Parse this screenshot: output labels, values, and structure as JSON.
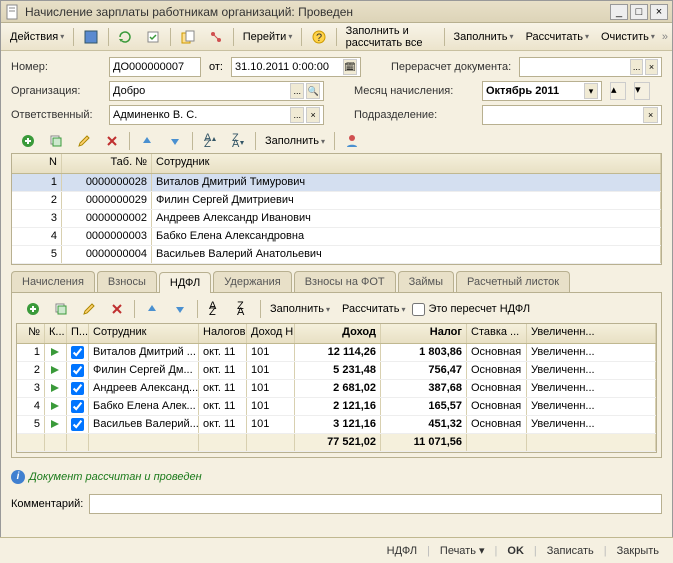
{
  "window": {
    "title": "Начисление зарплаты работникам организаций: Проведен"
  },
  "toolbar_main": {
    "actions": "Действия",
    "goto": "Перейти",
    "fill_calc_all": "Заполнить и рассчитать все",
    "fill": "Заполнить",
    "calc": "Рассчитать",
    "clear": "Очистить"
  },
  "form": {
    "number_label": "Номер:",
    "number_value": "ДО000000007",
    "date_from": "от:",
    "date_value": "31.10.2011 0:00:00",
    "org_label": "Организация:",
    "org_value": "Добро",
    "resp_label": "Ответственный:",
    "resp_value": "Админенко В. С.",
    "recalc_label": "Перерасчет документа:",
    "recalc_value": "",
    "month_label": "Месяц начисления:",
    "month_value": "Октябрь 2011",
    "dept_label": "Подразделение:",
    "dept_value": ""
  },
  "mini_tb": {
    "fill": "Заполнить"
  },
  "grid1": {
    "cols": {
      "n": "N",
      "tab": "Таб. №",
      "emp": "Сотрудник"
    },
    "rows": [
      {
        "n": "1",
        "tab": "0000000028",
        "emp": "Виталов Дмитрий Тимурович"
      },
      {
        "n": "2",
        "tab": "0000000029",
        "emp": "Филин Сергей Дмитриевич"
      },
      {
        "n": "3",
        "tab": "0000000002",
        "emp": "Андреев Александр Иванович"
      },
      {
        "n": "4",
        "tab": "0000000003",
        "emp": "Бабко Елена Александровна"
      },
      {
        "n": "5",
        "tab": "0000000004",
        "emp": "Васильев Валерий Анатольевич"
      }
    ]
  },
  "tabs": {
    "t1": "Начисления",
    "t2": "Взносы",
    "t3": "НДФЛ",
    "t4": "Удержания",
    "t5": "Взносы на ФОТ",
    "t6": "Займы",
    "t7": "Расчетный листок"
  },
  "tab_tb": {
    "fill": "Заполнить",
    "calc": "Рассчитать",
    "recalc_chk": "Это пересчет НДФЛ"
  },
  "grid2": {
    "cols": {
      "n": "№",
      "k": "К...",
      "p": "П...",
      "emp": "Сотрудник",
      "per": "Налогов...",
      "code": "Доход Н...",
      "inc": "Доход",
      "tax": "Налог",
      "rate": "Ставка ...",
      "inc2": "Увеличенн..."
    },
    "rows": [
      {
        "n": "1",
        "emp": "Виталов Дмитрий ...",
        "per": "окт. 11",
        "code": "101",
        "inc": "12 114,26",
        "tax": "1 803,86",
        "rate": "Основная",
        "inc2": "Увеличенн..."
      },
      {
        "n": "2",
        "emp": "Филин Сергей Дм...",
        "per": "окт. 11",
        "code": "101",
        "inc": "5 231,48",
        "tax": "756,47",
        "rate": "Основная",
        "inc2": "Увеличенн..."
      },
      {
        "n": "3",
        "emp": "Андреев Александ...",
        "per": "окт. 11",
        "code": "101",
        "inc": "2 681,02",
        "tax": "387,68",
        "rate": "Основная",
        "inc2": "Увеличенн..."
      },
      {
        "n": "4",
        "emp": "Бабко Елена Алек...",
        "per": "окт. 11",
        "code": "101",
        "inc": "2 121,16",
        "tax": "165,57",
        "rate": "Основная",
        "inc2": "Увеличенн..."
      },
      {
        "n": "5",
        "emp": "Васильев Валерий...",
        "per": "окт. 11",
        "code": "101",
        "inc": "3 121,16",
        "tax": "451,32",
        "rate": "Основная",
        "inc2": "Увеличенн..."
      }
    ],
    "totals": {
      "inc": "77 521,02",
      "tax": "11 071,56"
    }
  },
  "status": "Документ рассчитан и проведен",
  "comment_label": "Комментарий:",
  "comment_value": "",
  "bottom": {
    "ndfl": "НДФЛ",
    "print": "Печать",
    "ok": "OK",
    "save": "Записать",
    "close": "Закрыть"
  }
}
